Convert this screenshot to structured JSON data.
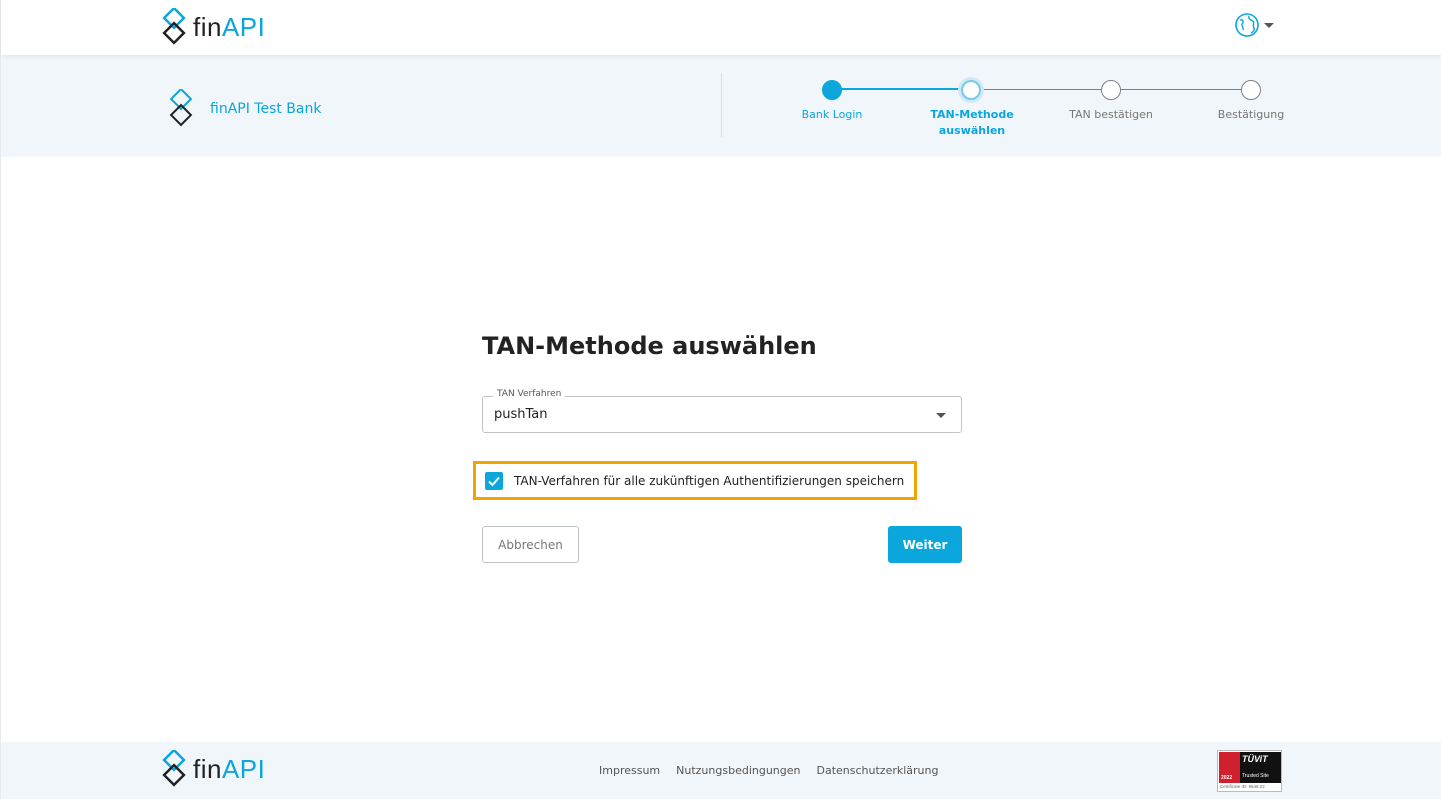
{
  "header": {
    "logo_fin": "fin",
    "logo_api": "API",
    "language_icon": "globe-icon"
  },
  "bank": {
    "name": "finAPI Test Bank"
  },
  "stepper": {
    "steps": [
      {
        "label": "Bank Login",
        "state": "done"
      },
      {
        "label": "TAN-Methode auswählen",
        "state": "current"
      },
      {
        "label": "TAN bestätigen",
        "state": "pending"
      },
      {
        "label": "Bestätigung",
        "state": "pending"
      }
    ]
  },
  "main": {
    "title": "TAN-Methode auswählen",
    "select": {
      "legend": "TAN Verfahren",
      "value": "pushTan"
    },
    "checkbox": {
      "label": "TAN-Verfahren für alle zukünftigen Authentifizierungen speichern",
      "checked": true
    },
    "cancel_label": "Abbrechen",
    "next_label": "Weiter"
  },
  "footer": {
    "logo_fin": "fin",
    "logo_api": "API",
    "links": [
      "Impressum",
      "Nutzungsbedingungen",
      "Datenschutzerklärung"
    ],
    "seal": {
      "brand": "TÜViT",
      "caption": "Trusted Site",
      "year": "2022",
      "certificate": "Certificate ID: 9548.22"
    }
  },
  "colors": {
    "accent": "#0aa6dc",
    "highlight": "#f0a500"
  }
}
